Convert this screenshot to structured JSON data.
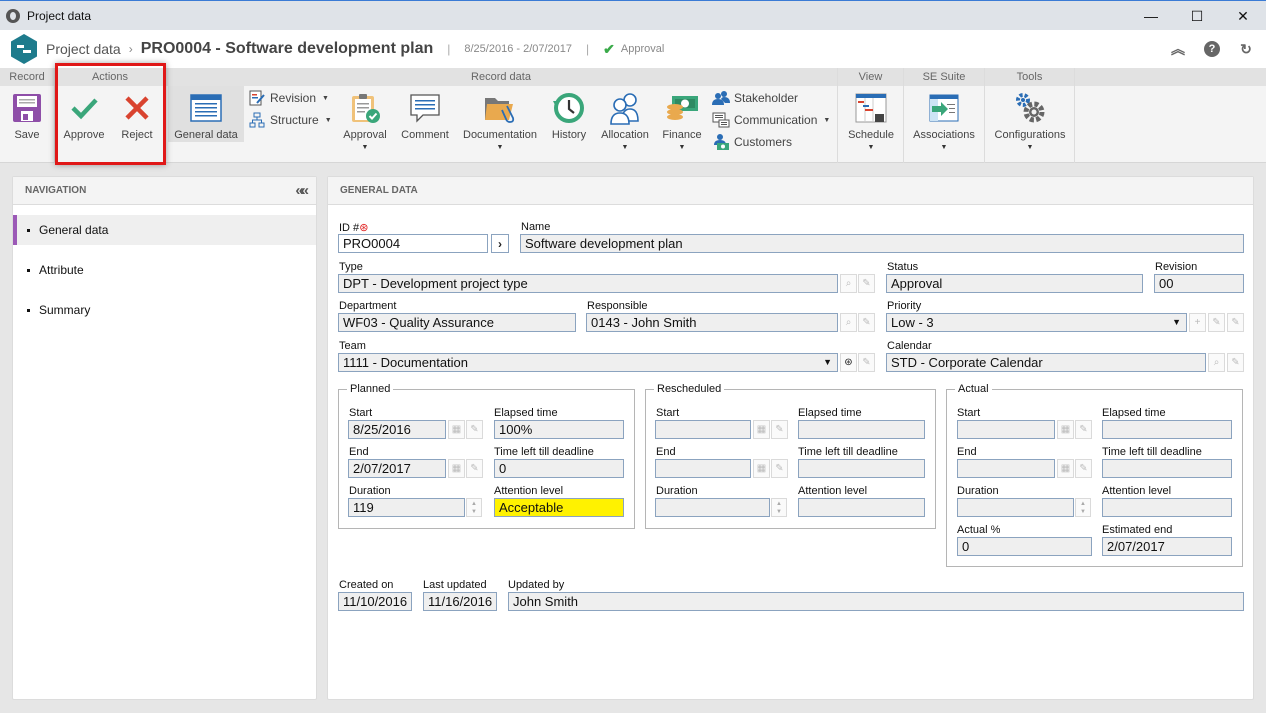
{
  "window": {
    "title": "Project data",
    "controls": {
      "minimize": "—",
      "maximize": "☐",
      "close": "✕"
    }
  },
  "header": {
    "breadcrumb_root": "Project data",
    "separator": "›",
    "title": "PRO0004 - Software development plan",
    "dates": "8/25/2016 - 2/07/2017",
    "status": "Approval",
    "status_color": "#3aaa4a",
    "icons": [
      "collapse-up-icon",
      "help-icon",
      "refresh-icon"
    ]
  },
  "ribbon": {
    "groups": {
      "record": "Record",
      "actions": "Actions",
      "record_data": "Record data",
      "view": "View",
      "se_suite": "SE Suite",
      "tools": "Tools"
    },
    "buttons": {
      "save": "Save",
      "approve": "Approve",
      "reject": "Reject",
      "general_data": "General data",
      "revision": "Revision",
      "structure": "Structure",
      "approval": "Approval",
      "comment": "Comment",
      "documentation": "Documentation",
      "history": "History",
      "allocation": "Allocation",
      "finance": "Finance",
      "stakeholder": "Stakeholder",
      "communication": "Communication",
      "customers": "Customers",
      "schedule": "Schedule",
      "associations": "Associations",
      "configurations": "Configurations"
    },
    "caret": "▼"
  },
  "navigation": {
    "title": "NAVIGATION",
    "collapse": "««",
    "items": [
      {
        "label": "General data",
        "active": true
      },
      {
        "label": "Attribute",
        "active": false
      },
      {
        "label": "Summary",
        "active": false
      }
    ]
  },
  "general": {
    "title": "GENERAL DATA",
    "id_label": "ID #",
    "required_mark": "⊛",
    "id_value": "PRO0004",
    "go": "›",
    "name_label": "Name",
    "name_value": "Software development plan",
    "type_label": "Type",
    "type_value": "DPT - Development project type",
    "status_label": "Status",
    "status_value": "Approval",
    "revision_label": "Revision",
    "revision_value": "00",
    "department_label": "Department",
    "department_value": "WF03 - Quality Assurance",
    "responsible_label": "Responsible",
    "responsible_value": "0143 - John Smith",
    "priority_label": "Priority",
    "priority_value": "Low - 3",
    "team_label": "Team",
    "team_value": "1111 - Documentation",
    "calendar_label": "Calendar",
    "calendar_value": "STD - Corporate Calendar",
    "dropdown_caret": "▼"
  },
  "planned": {
    "legend": "Planned",
    "start_label": "Start",
    "start_value": "8/25/2016",
    "end_label": "End",
    "end_value": "2/07/2017",
    "duration_label": "Duration",
    "duration_value": "119",
    "elapsed_label": "Elapsed time",
    "elapsed_value": "100%",
    "timeleft_label": "Time left till deadline",
    "timeleft_value": "0",
    "attention_label": "Attention level",
    "attention_value": "Acceptable",
    "attention_color": "#fff200"
  },
  "rescheduled": {
    "legend": "Rescheduled",
    "start_label": "Start",
    "start_value": "",
    "end_label": "End",
    "end_value": "",
    "duration_label": "Duration",
    "duration_value": "",
    "elapsed_label": "Elapsed time",
    "elapsed_value": "",
    "timeleft_label": "Time left till deadline",
    "timeleft_value": "",
    "attention_label": "Attention level",
    "attention_value": ""
  },
  "actual": {
    "legend": "Actual",
    "start_label": "Start",
    "start_value": "",
    "end_label": "End",
    "end_value": "",
    "duration_label": "Duration",
    "duration_value": "",
    "elapsed_label": "Elapsed time",
    "elapsed_value": "",
    "timeleft_label": "Time left till deadline",
    "timeleft_value": "",
    "attention_label": "Attention level",
    "attention_value": "",
    "actual_pct_label": "Actual %",
    "actual_pct_value": "0",
    "est_end_label": "Estimated end",
    "est_end_value": "2/07/2017"
  },
  "footer_fields": {
    "created_label": "Created on",
    "created_value": "11/10/2016",
    "updated_label": "Last updated",
    "updated_value": "11/16/2016",
    "updated_by_label": "Updated by",
    "updated_by_value": "John Smith"
  }
}
